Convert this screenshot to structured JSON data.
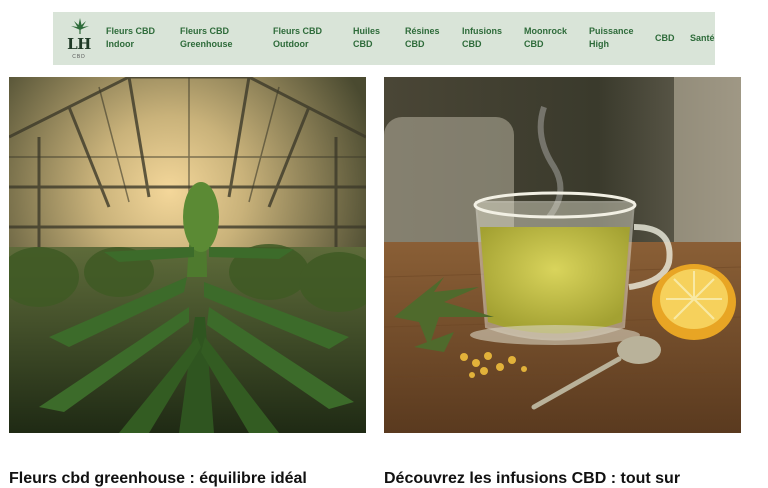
{
  "logo": {
    "text": "LH",
    "sub": "CBD"
  },
  "nav": {
    "items": [
      {
        "line1": "Fleurs CBD",
        "line2": "Indoor"
      },
      {
        "line1": "Fleurs CBD",
        "line2": "Greenhouse"
      },
      {
        "line1": "Fleurs CBD",
        "line2": "Outdoor"
      },
      {
        "line1": "Huiles",
        "line2": "CBD"
      },
      {
        "line1": "Résines",
        "line2": "CBD"
      },
      {
        "line1": "Infusions",
        "line2": "CBD"
      },
      {
        "line1": "Moonrock",
        "line2": "CBD"
      },
      {
        "line1": "Puissance",
        "line2": "High"
      },
      {
        "line1": "CBD",
        "line2": ""
      },
      {
        "line1": "Santé",
        "line2": ""
      }
    ]
  },
  "articles": [
    {
      "title": "Fleurs cbd greenhouse : équilibre idéal"
    },
    {
      "title": "Découvrez les infusions CBD : tout sur"
    }
  ],
  "colors": {
    "navbar_bg": "#d9e4d8",
    "nav_text": "#2e6b3a"
  }
}
